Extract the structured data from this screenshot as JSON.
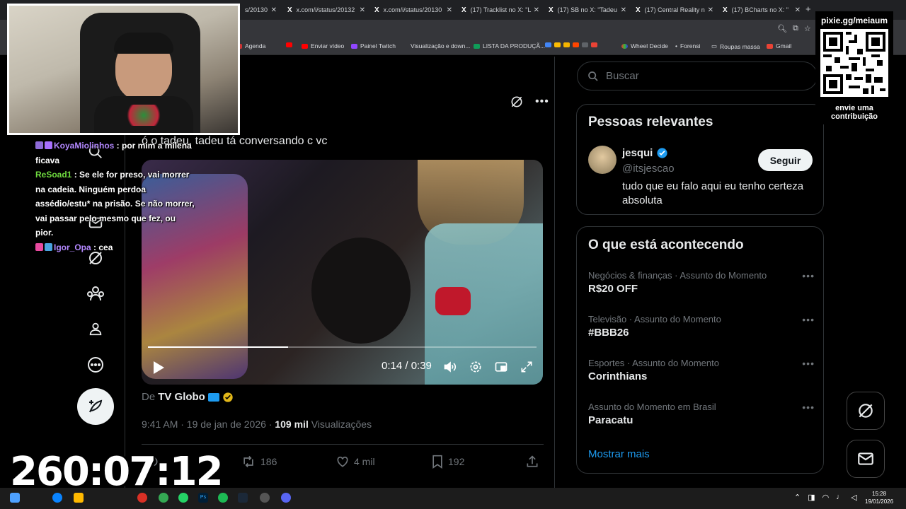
{
  "browser": {
    "tabs": [
      {
        "label": "s/20130"
      },
      {
        "label": "x.com/i/status/20132"
      },
      {
        "label": "x.com/i/status/20130"
      },
      {
        "label": "(17) Tracklist no X: \"L"
      },
      {
        "label": "(17) SB no X: \"Tadeu"
      },
      {
        "label": "(17) Central Reality n"
      },
      {
        "label": "(17) BCharts no X: \""
      }
    ],
    "bookmarks": [
      {
        "label": "Agenda"
      },
      {
        "label": ""
      },
      {
        "label": "Enviar vídeo"
      },
      {
        "label": "Painel Twitch"
      },
      {
        "label": "Visualização e down..."
      },
      {
        "label": "LISTA DA PRODUÇÃ..."
      },
      {
        "label": "Wheel Decide"
      },
      {
        "label": "Forensi"
      },
      {
        "label": "Roupas massa"
      },
      {
        "label": "Gmail"
      }
    ]
  },
  "tweet": {
    "text": "ó o tadeu, tadeu tá conversando c vc",
    "video": {
      "time": "0:14 / 0:39",
      "progress": 0.36
    },
    "source_prefix": "De",
    "source_name": "TV Globo",
    "time": "9:41 AM · 19 de jan de 2026 ·",
    "views_count": "109 mil",
    "views_label": "Visualizações",
    "actions": {
      "replies": "",
      "retweets": "186",
      "likes": "4 mil",
      "bookmarks": "192"
    }
  },
  "sidebar": {
    "search_placeholder": "Buscar",
    "relevant": {
      "title": "Pessoas relevantes",
      "name": "jesqui",
      "handle": "@itsjescao",
      "bio": "tudo que eu falo aqui eu tenho certeza absoluta",
      "follow_label": "Seguir"
    },
    "trends": {
      "title": "O que está acontecendo",
      "items": [
        {
          "category": "Negócios & finanças · Assunto do Momento",
          "name": "R$20 OFF"
        },
        {
          "category": "Televisão · Assunto do Momento",
          "name": "#BBB26"
        },
        {
          "category": "Esportes · Assunto do Momento",
          "name": "Corinthians"
        },
        {
          "category": "Assunto do Momento em Brasil",
          "name": "Paracatu"
        }
      ],
      "show_more": "Mostrar mais"
    }
  },
  "stream": {
    "chat": [
      {
        "user": "KoyaMiolinhos",
        "message": "por mim a milena ficava"
      },
      {
        "user": "ReSoad1",
        "message": "Se ele for preso, vai morrer na cadeia. Ninguém perdoa assédio/estu* na prisão. Se não morrer, vai passar pelo mesmo que fez, ou pior."
      },
      {
        "user": "Igor_Opa",
        "message": "cea"
      }
    ],
    "qr_title": "pixie.gg/meiaum",
    "qr_caption": "envie uma contribuição",
    "timer": "260:07:12"
  },
  "taskbar": {
    "time": "15:28",
    "date": "19/01/2026"
  },
  "colors": {
    "accent": "#1d9bf0",
    "verified_gold": "#e2b719"
  }
}
